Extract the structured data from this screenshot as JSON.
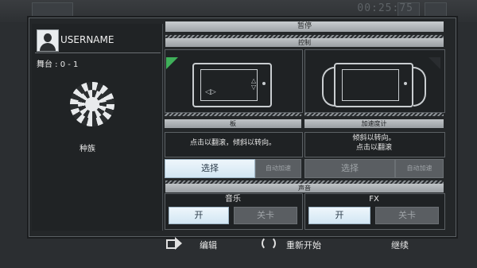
{
  "hud": {
    "time": "00:25:75"
  },
  "pause": {
    "title": "暂停"
  },
  "player": {
    "username": "USERNAME",
    "stage": "舞台 : 0 - 1",
    "race_label": "种族"
  },
  "controls": {
    "title": "控制",
    "board": {
      "title": "板",
      "desc": "点击以翻滚，倾斜以转向。",
      "select": "选择",
      "auto_accel": "自动加速"
    },
    "accel": {
      "title": "加速度计",
      "desc_line1": "倾斜以转向。",
      "desc_line2": "点击以翻滚",
      "select": "选择",
      "auto_accel": "自动加速"
    }
  },
  "sound": {
    "title": "声音",
    "music": {
      "label": "音乐",
      "on": "开",
      "off": "关卡"
    },
    "fx": {
      "label": "FX",
      "on": "开",
      "off": "关卡"
    }
  },
  "footer": {
    "edit": "编辑",
    "restart": "重新开始",
    "continue": "继续"
  }
}
